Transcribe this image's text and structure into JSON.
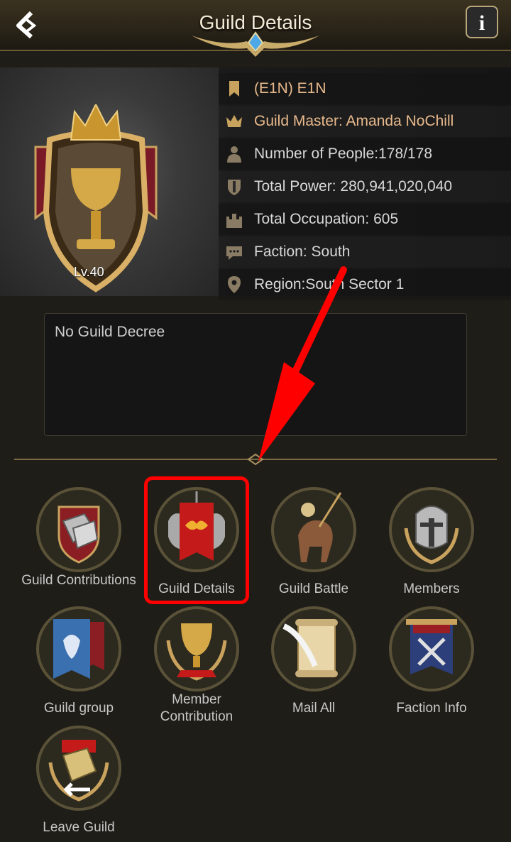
{
  "header": {
    "title": "Guild Details",
    "info_label": "i"
  },
  "guild": {
    "level": "Lv.40",
    "name": "(E1N) E1N",
    "master": "Guild Master: Amanda NoChill",
    "people": "Number of People:178/178",
    "power": "Total Power: 280,941,020,040",
    "occupation": "Total Occupation: 605",
    "faction": "Faction: South",
    "region": "Region:South Sector 1"
  },
  "decree": {
    "text": "No Guild Decree"
  },
  "menu": {
    "items": [
      {
        "label": "Guild Contributions",
        "icon": "gauntlet-shield-icon"
      },
      {
        "label": "Guild Details",
        "icon": "banner-lion-icon"
      },
      {
        "label": "Guild Battle",
        "icon": "warrior-horse-icon"
      },
      {
        "label": "Members",
        "icon": "helmet-wreath-icon"
      },
      {
        "label": "Guild group",
        "icon": "blue-banner-icon"
      },
      {
        "label": "Member Contribution",
        "icon": "trophy-cup-icon"
      },
      {
        "label": "Mail All",
        "icon": "scroll-quill-icon"
      },
      {
        "label": "Faction Info",
        "icon": "crossed-swords-banner-icon"
      },
      {
        "label": "Leave Guild",
        "icon": "gauntlet-exit-icon"
      }
    ]
  },
  "colors": {
    "highlight": "#ff0000",
    "gold_text": "#e8b98c",
    "arrow": "#ff0000"
  }
}
